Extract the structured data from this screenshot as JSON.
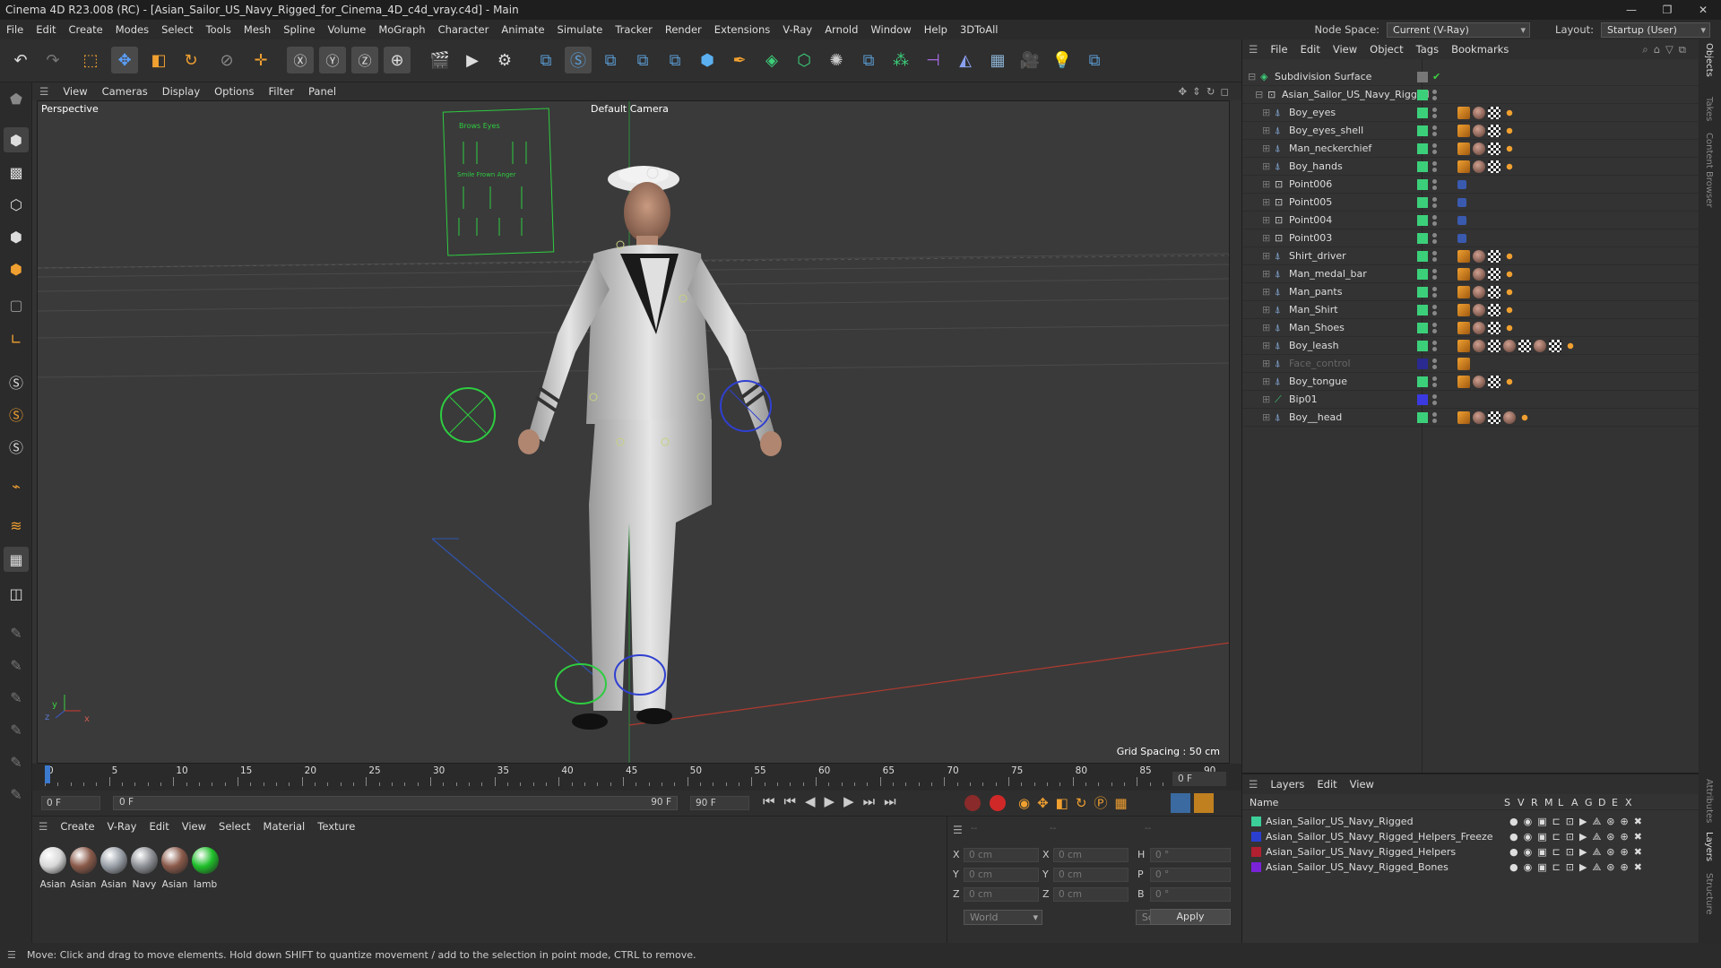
{
  "window": {
    "title": "Cinema 4D R23.008 (RC) - [Asian_Sailor_US_Navy_Rigged_for_Cinema_4D_c4d_vray.c4d] - Main",
    "minimize": "—",
    "restore": "❐",
    "close": "✕"
  },
  "menubar": {
    "items": [
      "File",
      "Edit",
      "Create",
      "Modes",
      "Select",
      "Tools",
      "Mesh",
      "Spline",
      "Volume",
      "MoGraph",
      "Character",
      "Animate",
      "Simulate",
      "Tracker",
      "Render",
      "Extensions",
      "V-Ray",
      "Arnold",
      "Window",
      "Help",
      "3DToAll"
    ],
    "node_space_label": "Node Space:",
    "node_space_value": "Current (V-Ray)",
    "layout_label": "Layout:",
    "layout_value": "Startup (User)"
  },
  "viewport": {
    "menu": [
      "View",
      "Cameras",
      "Display",
      "Options",
      "Filter",
      "Panel"
    ],
    "label": "Perspective",
    "camera": "Default Camera",
    "grid_spacing": "Grid Spacing : 50 cm",
    "axis_y": "y",
    "axis_z": "z",
    "axis_x": "x"
  },
  "timeline": {
    "ticks": [
      "0",
      "5",
      "10",
      "15",
      "20",
      "25",
      "30",
      "35",
      "40",
      "45",
      "50",
      "55",
      "60",
      "65",
      "70",
      "75",
      "80",
      "85",
      "90"
    ],
    "current_frame": "0 F",
    "start_field": "0 F",
    "range_start": "0 F",
    "range_end": "90 F",
    "end_field": "90 F"
  },
  "materials": {
    "menu": [
      "Create",
      "V-Ray",
      "Edit",
      "View",
      "Select",
      "Material",
      "Texture"
    ],
    "items": [
      {
        "label": "Asian",
        "color": "#d8d8d8"
      },
      {
        "label": "Asian",
        "color": "#8a5a4a"
      },
      {
        "label": "Asian",
        "color": "#9aa0a8"
      },
      {
        "label": "Navy",
        "color": "#8e9196"
      },
      {
        "label": "Asian",
        "color": "#8a5a4a"
      },
      {
        "label": "lamb",
        "color": "#1fbf2a"
      }
    ]
  },
  "attributes": {
    "header": [
      "--",
      "--",
      "--"
    ],
    "x_label": "X",
    "y_label": "Y",
    "z_label": "Z",
    "h_label": "H",
    "p_label": "P",
    "b_label": "B",
    "pos_x": "0 cm",
    "pos_y": "0 cm",
    "pos_z": "0 cm",
    "size_x": "0 cm",
    "size_y": "0 cm",
    "size_z": "0 cm",
    "rot_h": "0 °",
    "rot_p": "0 °",
    "rot_b": "0 °",
    "coord_system": "World",
    "mode": "Scale",
    "apply": "Apply"
  },
  "objects": {
    "menu": [
      "File",
      "Edit",
      "View",
      "Object",
      "Tags",
      "Bookmarks"
    ],
    "root": "Subdivision Surface",
    "group": "Asian_Sailor_US_Navy_Rigged",
    "items": [
      {
        "name": "Boy_eyes",
        "type": "mesh",
        "tags": 4
      },
      {
        "name": "Boy_eyes_shell",
        "type": "mesh",
        "tags": 4
      },
      {
        "name": "Man_neckerchief",
        "type": "mesh",
        "tags": 4
      },
      {
        "name": "Boy_hands",
        "type": "mesh",
        "tags": 4
      },
      {
        "name": "Point006",
        "type": "null",
        "tags": 1
      },
      {
        "name": "Point005",
        "type": "null",
        "tags": 1
      },
      {
        "name": "Point004",
        "type": "null",
        "tags": 1
      },
      {
        "name": "Point003",
        "type": "null",
        "tags": 1
      },
      {
        "name": "Shirt_driver",
        "type": "mesh",
        "tags": 4
      },
      {
        "name": "Man_medal_bar",
        "type": "mesh",
        "tags": 4
      },
      {
        "name": "Man_pants",
        "type": "mesh",
        "tags": 4
      },
      {
        "name": "Man_Shirt",
        "type": "mesh",
        "tags": 4
      },
      {
        "name": "Man_Shoes",
        "type": "mesh",
        "tags": 4
      },
      {
        "name": "Boy_leash",
        "type": "mesh",
        "tags": 8
      },
      {
        "name": "Face_control",
        "type": "mesh",
        "tags": 1,
        "dim": true
      },
      {
        "name": "Boy_tongue",
        "type": "mesh",
        "tags": 4
      },
      {
        "name": "Bip01",
        "type": "bone",
        "tags": 0
      },
      {
        "name": "Boy__head",
        "type": "mesh",
        "tags": 5
      }
    ]
  },
  "layers": {
    "menu": [
      "Layers",
      "Edit",
      "View"
    ],
    "col_name": "Name",
    "cols": [
      "S",
      "V",
      "R",
      "M",
      "L",
      "A",
      "G",
      "D",
      "E",
      "X"
    ],
    "items": [
      {
        "name": "Asian_Sailor_US_Navy_Rigged",
        "color": "#3ccf9a"
      },
      {
        "name": "Asian_Sailor_US_Navy_Rigged_Helpers_Freeze",
        "color": "#2a3fd0"
      },
      {
        "name": "Asian_Sailor_US_Navy_Rigged_Helpers",
        "color": "#b02030"
      },
      {
        "name": "Asian_Sailor_US_Navy_Rigged_Bones",
        "color": "#7a22d8"
      }
    ]
  },
  "right_tabs": [
    "Objects",
    "Takes",
    "Content Browser",
    "Attributes",
    "Layers",
    "Structure"
  ],
  "status": "Move: Click and drag to move elements. Hold down SHIFT to quantize movement / add to the selection in point mode, CTRL to remove."
}
